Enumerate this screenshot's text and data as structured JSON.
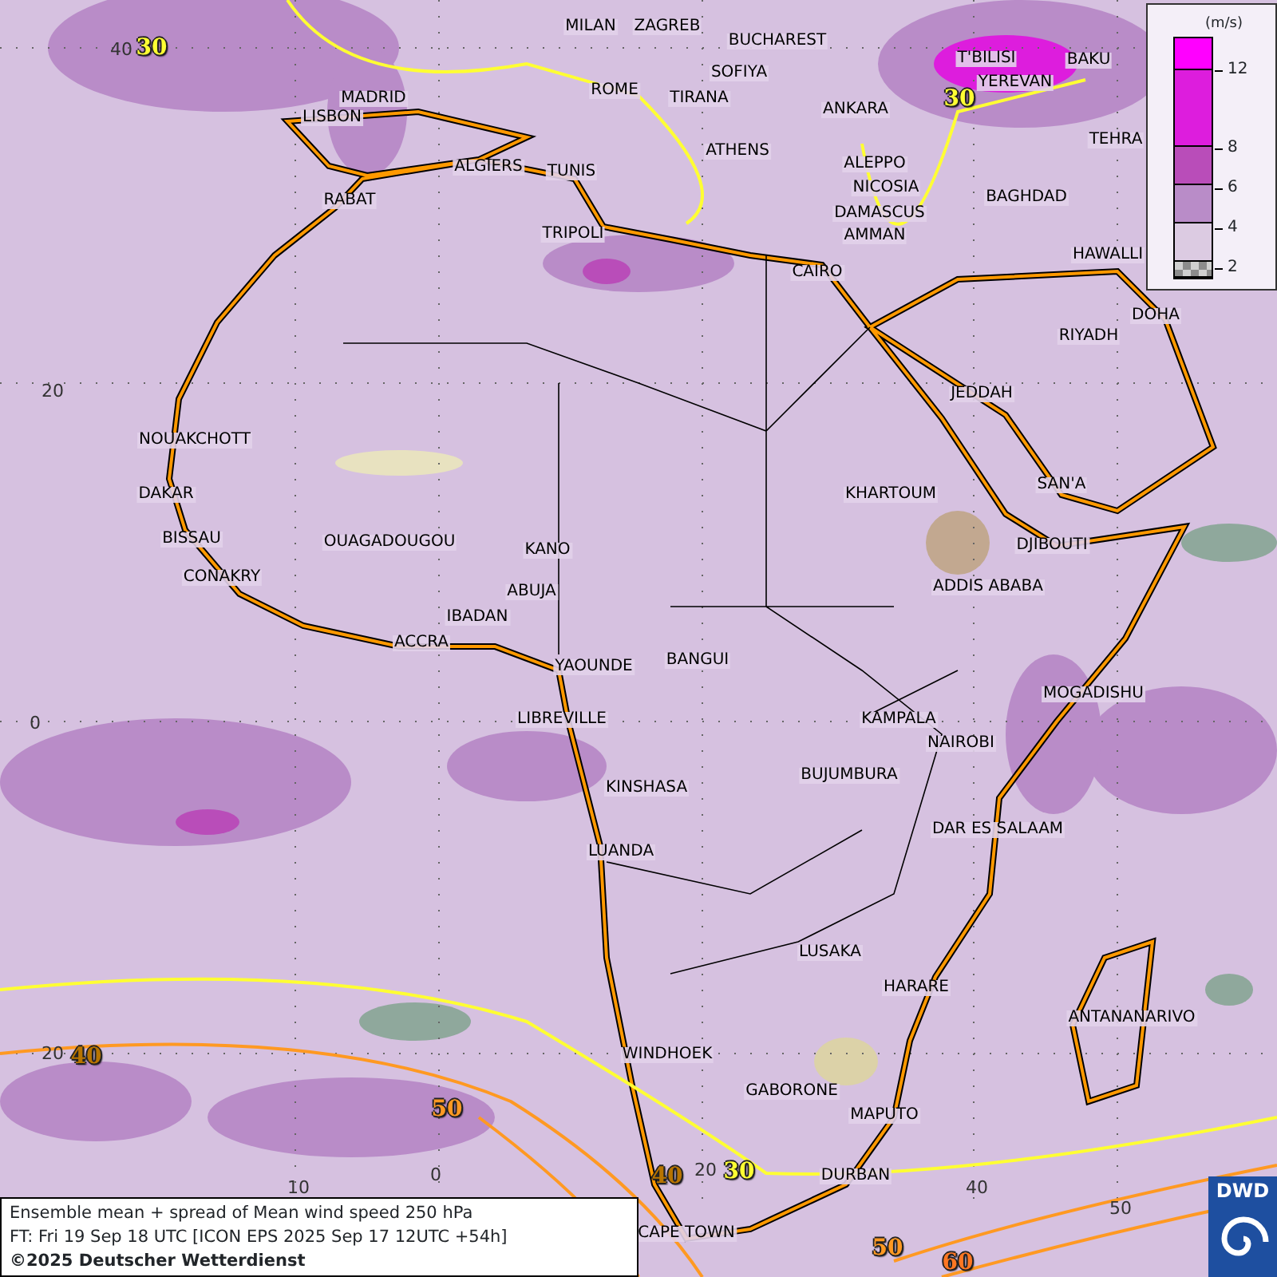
{
  "map": {
    "cities": [
      "MILAN",
      "ZAGREB",
      "BUCHAREST",
      "T'BILISI",
      "BAKU",
      "SOFIYA",
      "YEREVAN",
      "ROME",
      "MADRID",
      "TIRANA",
      "ANKARA",
      "LISBON",
      "TEHRA",
      "ATHENS",
      "ALGIERS",
      "TUNIS",
      "ALEPPO",
      "NICOSIA",
      "RABAT",
      "BAGHDAD",
      "DAMASCUS",
      "TRIPOLI",
      "AMMAN",
      "HAWALLI",
      "CAIRO",
      "DOHA",
      "RIYADH",
      "JEDDAH",
      "NOUAKCHOTT",
      "SAN'A",
      "DAKAR",
      "KHARTOUM",
      "BISSAU",
      "OUAGADOUGOU",
      "KANO",
      "DJIBOUTI",
      "CONAKRY",
      "ABUJA",
      "ADDIS ABABA",
      "IBADAN",
      "ACCRA",
      "YAOUNDE",
      "BANGUI",
      "MOGADISHU",
      "LIBREVILLE",
      "KAMPALA",
      "NAIROBI",
      "BUJUMBURA",
      "KINSHASA",
      "DAR ES SALAAM",
      "LUANDA",
      "LUSAKA",
      "HARARE",
      "ANTANANARIVO",
      "WINDHOEK",
      "GABORONE",
      "MAPUTO",
      "DURBAN",
      "CAPE TOWN"
    ],
    "grid_labels": [
      "40",
      "20",
      "0",
      "20",
      "10",
      "0",
      "20",
      "40",
      "50"
    ],
    "contour_labels": [
      {
        "text": "30",
        "color": "#ffff33"
      },
      {
        "text": "30",
        "color": "#ffff33"
      },
      {
        "text": "40",
        "color": "#b87400"
      },
      {
        "text": "50",
        "color": "#ff9922"
      },
      {
        "text": "40",
        "color": "#b87400"
      },
      {
        "text": "30",
        "color": "#ffff33"
      },
      {
        "text": "50",
        "color": "#ff9922"
      },
      {
        "text": "60",
        "color": "#ff7722"
      }
    ]
  },
  "legend": {
    "unit": "(m/s)",
    "segments": [
      {
        "kind": "solid",
        "color": "#ff00ff"
      },
      {
        "kind": "solid",
        "color": "#dd1ddd"
      },
      {
        "kind": "solid",
        "color": "#b94db9"
      },
      {
        "kind": "solid",
        "color": "#b98cc8"
      },
      {
        "kind": "solid",
        "color": "#dccbe2"
      },
      {
        "kind": "checker",
        "color": "#8c8c8c"
      }
    ],
    "ticks": [
      "12",
      "8",
      "6",
      "4",
      "2"
    ]
  },
  "caption": {
    "title": "Ensemble mean + spread of Mean wind speed 250 hPa",
    "forecast_time": "FT: Fri 19 Sep 18 UTC [ICON EPS 2025 Sep 17 12UTC +54h]",
    "copyright": "©2025 Deutscher Wetterdienst"
  },
  "logo": {
    "text": "DWD"
  }
}
